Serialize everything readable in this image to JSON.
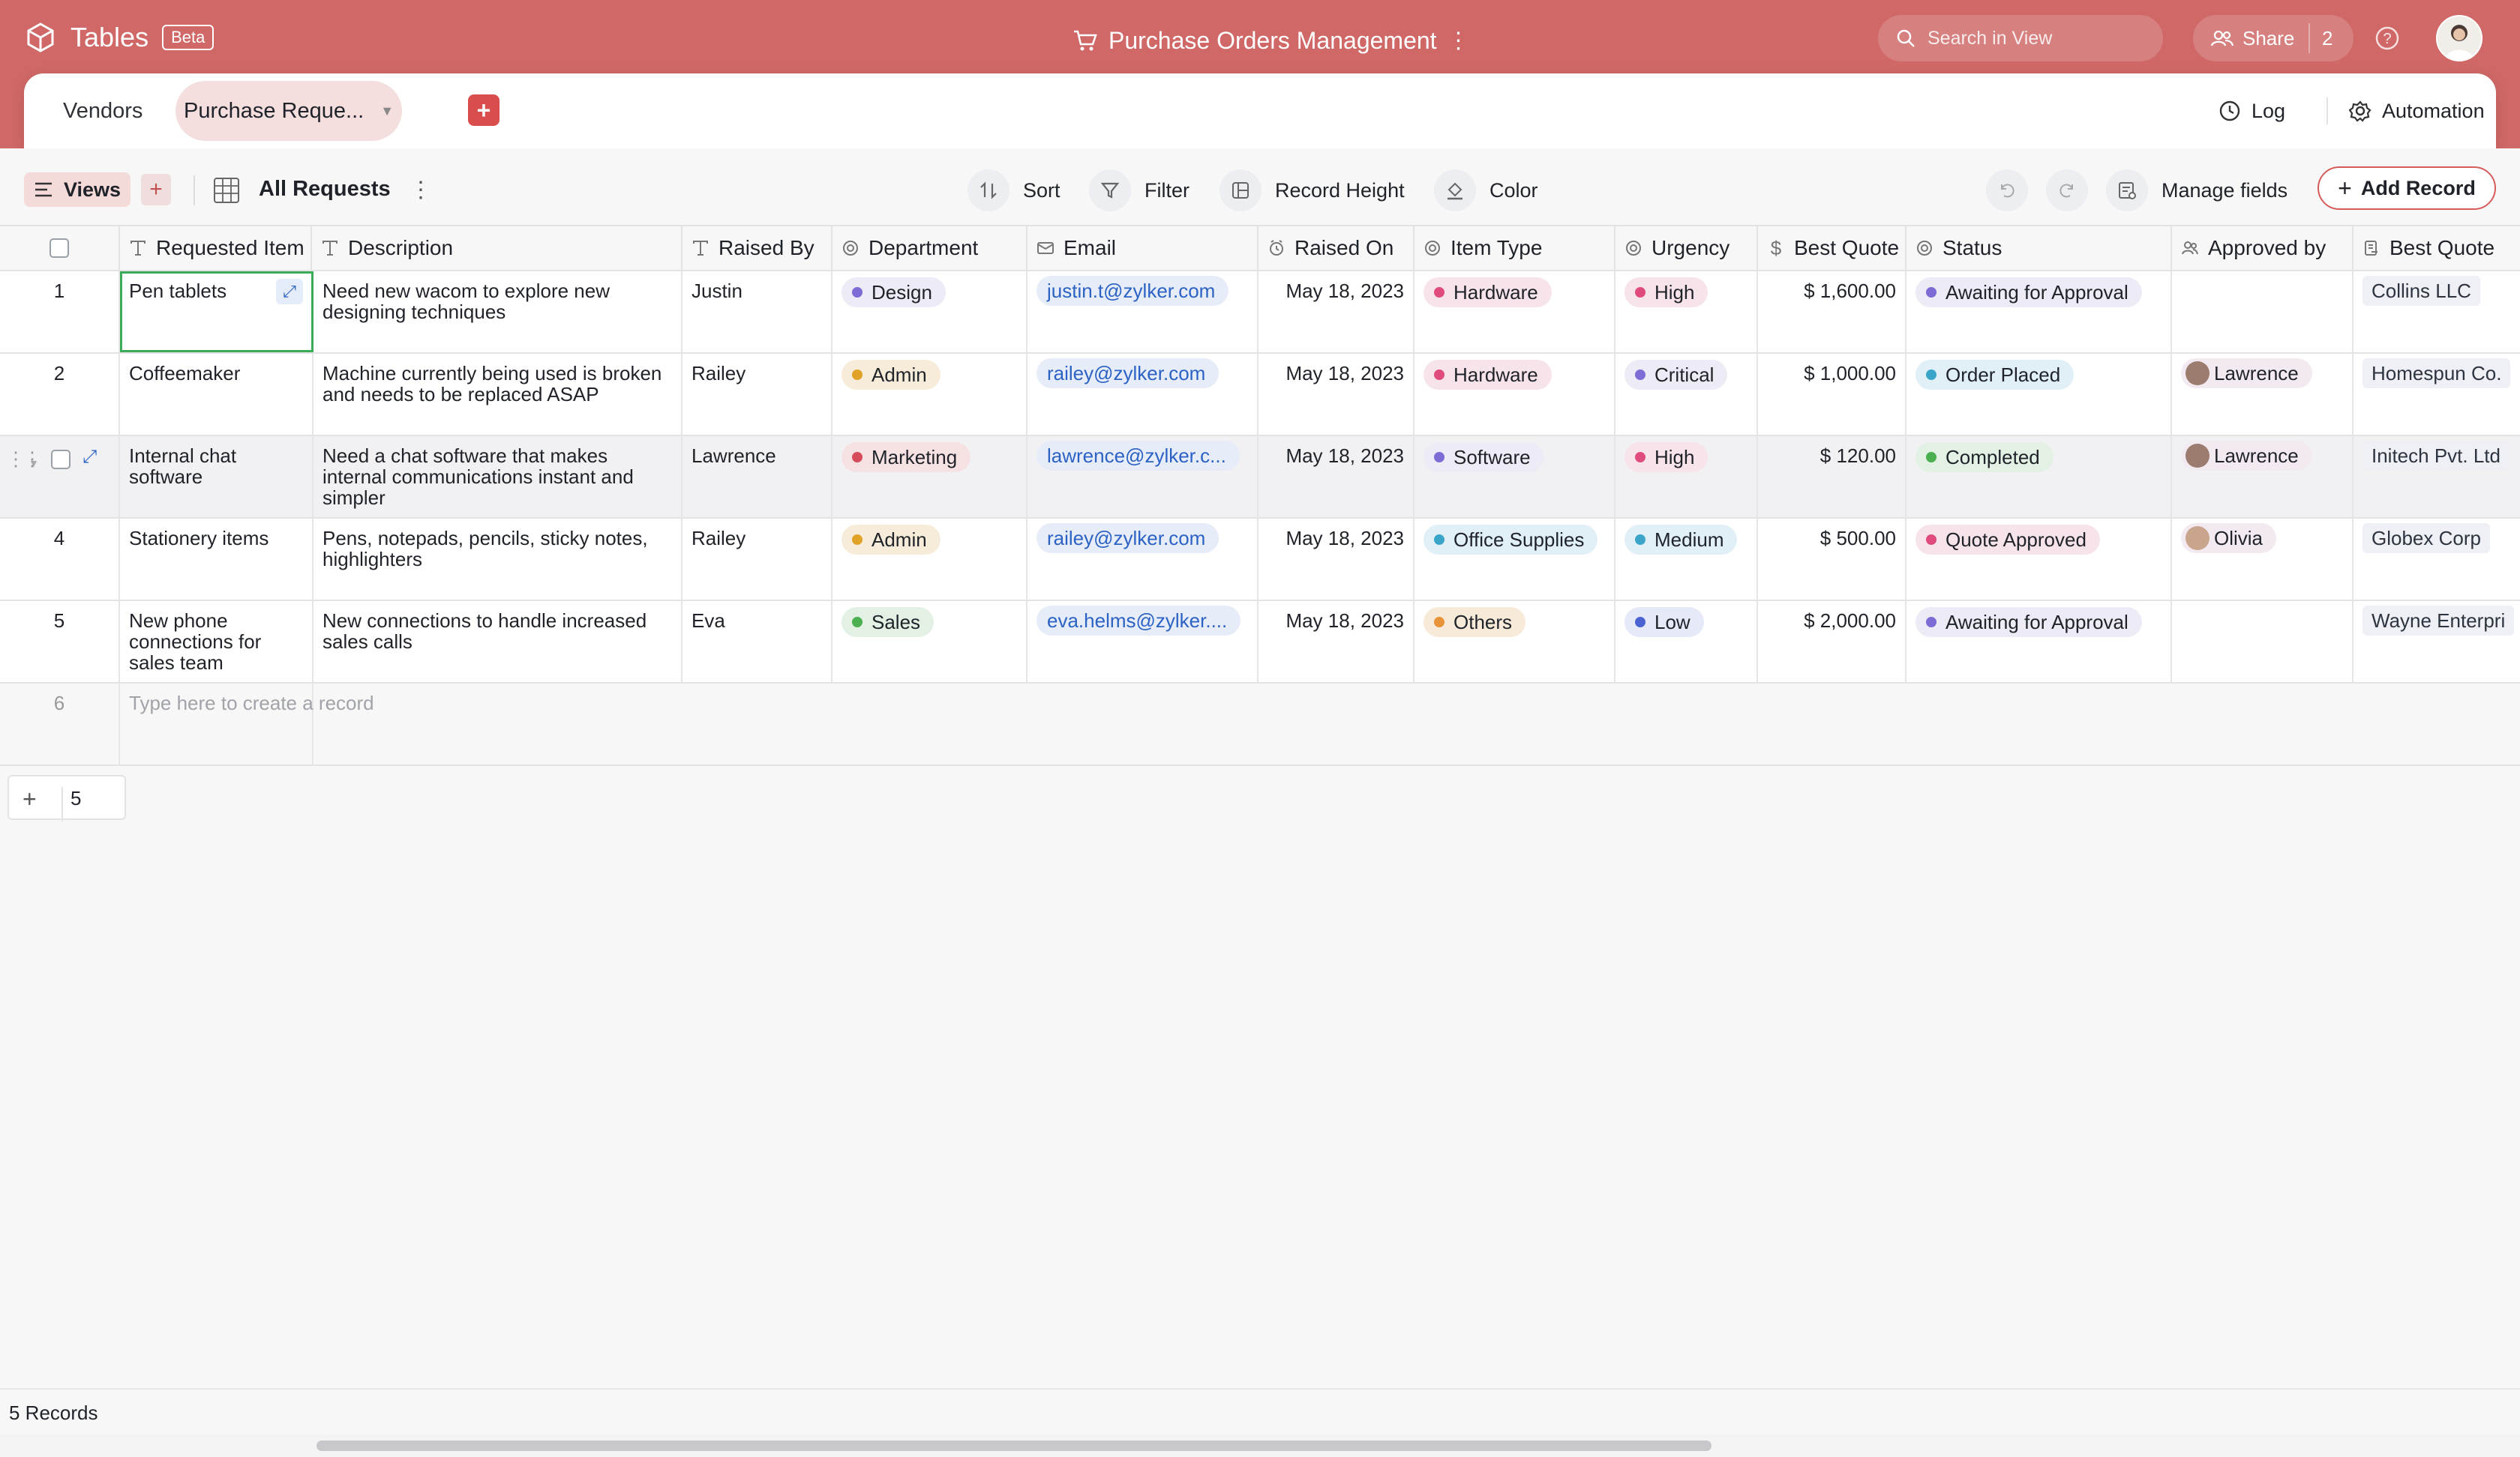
{
  "app": {
    "name": "Tables",
    "badge": "Beta",
    "doc_title": "Purchase Orders Management"
  },
  "search": {
    "placeholder": "Search in View"
  },
  "share": {
    "label": "Share",
    "count": "2"
  },
  "tabs": [
    {
      "label": "Vendors"
    },
    {
      "label": "Purchase Reque..."
    }
  ],
  "header_actions": {
    "log": "Log",
    "automation": "Automation"
  },
  "toolbar": {
    "views": "Views",
    "view_name": "All Requests",
    "sort": "Sort",
    "filter": "Filter",
    "record_height": "Record Height",
    "color": "Color",
    "manage_fields": "Manage fields",
    "add_record": "Add Record"
  },
  "columns": [
    "Requested Item",
    "Description",
    "Raised By",
    "Department",
    "Email",
    "Raised On",
    "Item Type",
    "Urgency",
    "Best Quote",
    "Status",
    "Approved by",
    "Best Quote"
  ],
  "rows": [
    {
      "n": "1",
      "item": "Pen tablets",
      "desc": "Need new wacom to explore new designing techniques",
      "raised_by": "Justin",
      "dept": "Design",
      "email": "justin.t@zylker.com",
      "date": "May 18, 2023",
      "type": "Hardware",
      "urgency": "High",
      "quote": "$ 1,600.00",
      "status": "Awaiting for Approval",
      "approved_by": "",
      "vendor": "Collins LLC"
    },
    {
      "n": "2",
      "item": "Coffeemaker",
      "desc": "Machine currently being used is broken and needs to be replaced ASAP",
      "raised_by": "Railey",
      "dept": "Admin",
      "email": "railey@zylker.com",
      "date": "May 18, 2023",
      "type": "Hardware",
      "urgency": "Critical",
      "quote": "$ 1,000.00",
      "status": "Order Placed",
      "approved_by": "Lawrence",
      "vendor": "Homespun Co."
    },
    {
      "n": "",
      "item": "Internal chat software",
      "desc": "Need a chat software that makes internal communications instant and simpler",
      "raised_by": "Lawrence",
      "dept": "Marketing",
      "email": "lawrence@zylker.c...",
      "date": "May 18, 2023",
      "type": "Software",
      "urgency": "High",
      "quote": "$ 120.00",
      "status": "Completed",
      "approved_by": "Lawrence",
      "vendor": "Initech Pvt. Ltd"
    },
    {
      "n": "4",
      "item": "Stationery items",
      "desc": "Pens, notepads, pencils, sticky notes, highlighters",
      "raised_by": "Railey",
      "dept": "Admin",
      "email": "railey@zylker.com",
      "date": "May 18, 2023",
      "type": "Office Supplies",
      "urgency": "Medium",
      "quote": "$ 500.00",
      "status": "Quote Approved",
      "approved_by": "Olivia",
      "vendor": "Globex Corp"
    },
    {
      "n": "5",
      "item": "New phone connections for sales team",
      "desc": "New connections to handle increased sales calls",
      "raised_by": "Eva",
      "dept": "Sales",
      "email": "eva.helms@zylker....",
      "date": "May 18, 2023",
      "type": "Others",
      "urgency": "Low",
      "quote": "$ 2,000.00",
      "status": "Awaiting for Approval",
      "approved_by": "",
      "vendor": "Wayne Enterpri"
    }
  ],
  "new_row": {
    "n": "6",
    "placeholder": "Type here to create a record"
  },
  "add_bar": {
    "count": "5"
  },
  "footer": {
    "records": "5 Records"
  },
  "colors": {
    "brand": "#cf6867",
    "accent": "#d94d4d",
    "selection": "#3cab57"
  }
}
